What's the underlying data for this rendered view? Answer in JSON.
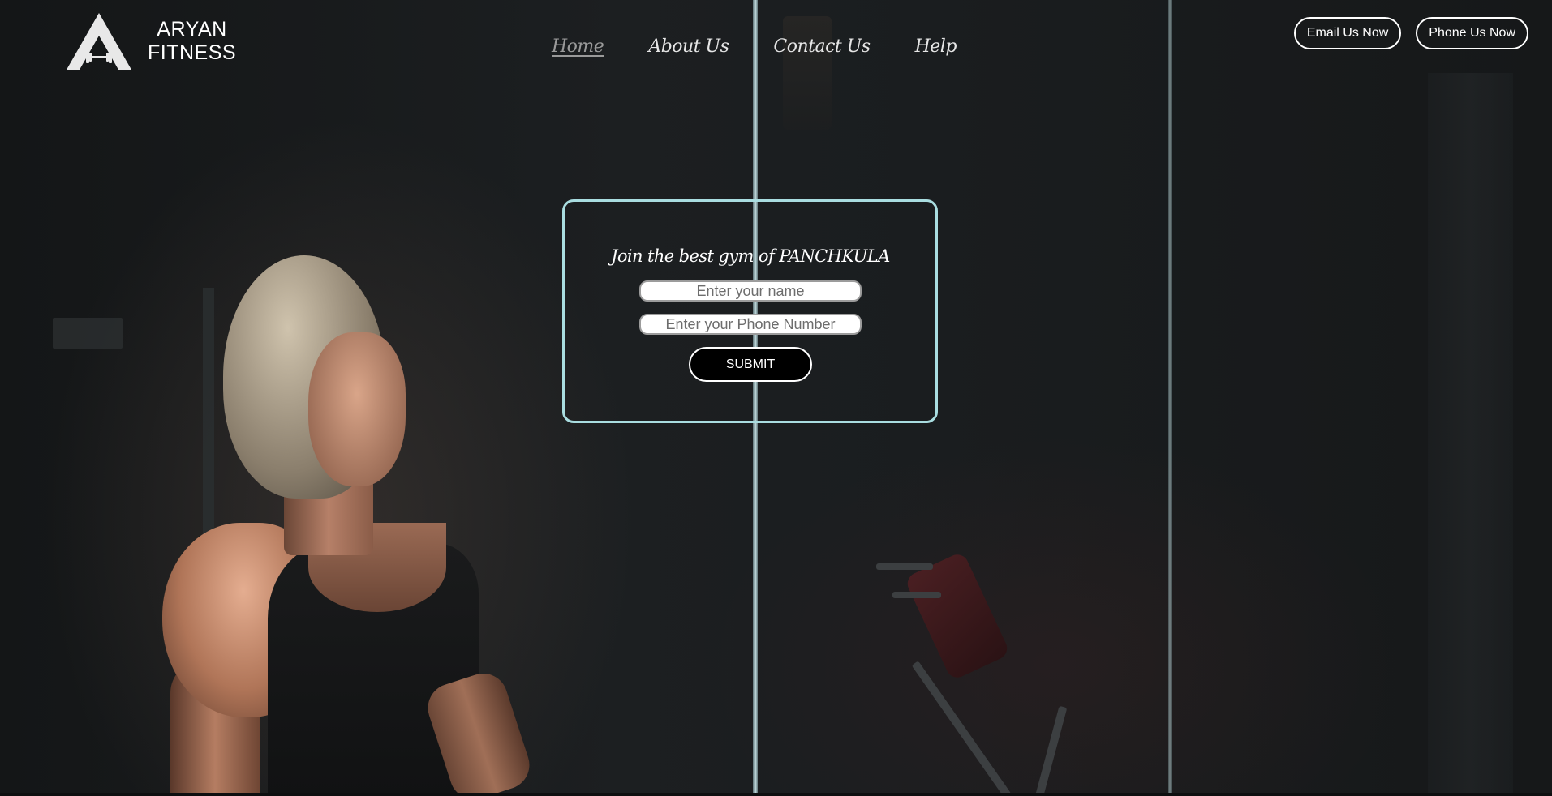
{
  "brand": {
    "name_line1": "ARYAN",
    "name_line2": "FITNESS",
    "logo_icon": "dumbbell-triangle-icon"
  },
  "nav": {
    "items": [
      {
        "label": "Home",
        "active": true
      },
      {
        "label": "About Us",
        "active": false
      },
      {
        "label": "Contact Us",
        "active": false
      },
      {
        "label": "Help",
        "active": false
      }
    ]
  },
  "cta": {
    "email_label": "Email Us Now",
    "phone_label": "Phone Us Now"
  },
  "signup": {
    "headline": "Join the best gym of PANCHKULA",
    "name_placeholder": "Enter your name",
    "phone_placeholder": "Enter your Phone Number",
    "submit_label": "SUBMIT"
  },
  "colors": {
    "card_border": "#a9dde0",
    "nav_active": "#9a9a9a",
    "background": "#1a1c1e"
  }
}
